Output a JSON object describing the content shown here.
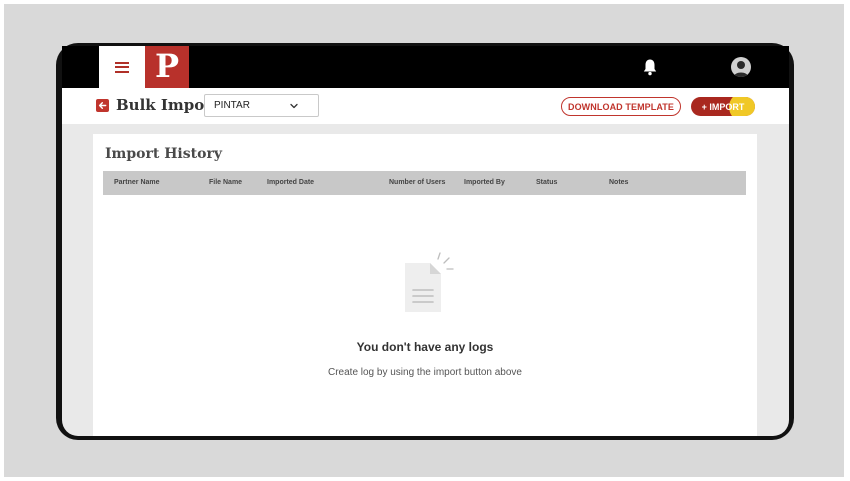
{
  "header": {
    "logo_text": "P",
    "menu_icon": "hamburger-menu-icon",
    "bell_icon": "bell-icon",
    "avatar_icon": "user-avatar-icon"
  },
  "subheader": {
    "back_icon": "arrow-left-icon",
    "title": "Bulk Import",
    "partner_select": {
      "value": "PINTAR"
    },
    "download_template_label": "DOWNLOAD TEMPLATE",
    "import_label": "+ IMPORT"
  },
  "history": {
    "title": "Import History",
    "columns": [
      "Partner Name",
      "File Name",
      "Imported Date",
      "Number of Users",
      "Imported By",
      "Status",
      "Notes"
    ]
  },
  "empty_state": {
    "icon": "empty-document-icon",
    "title": "You don't have any logs",
    "subtitle": "Create log by using the import button above"
  },
  "colors": {
    "brand_red": "#b8312b",
    "import_button": "#a9281f",
    "highlight": "#ffeb28",
    "table_header": "#c8c8c8"
  }
}
